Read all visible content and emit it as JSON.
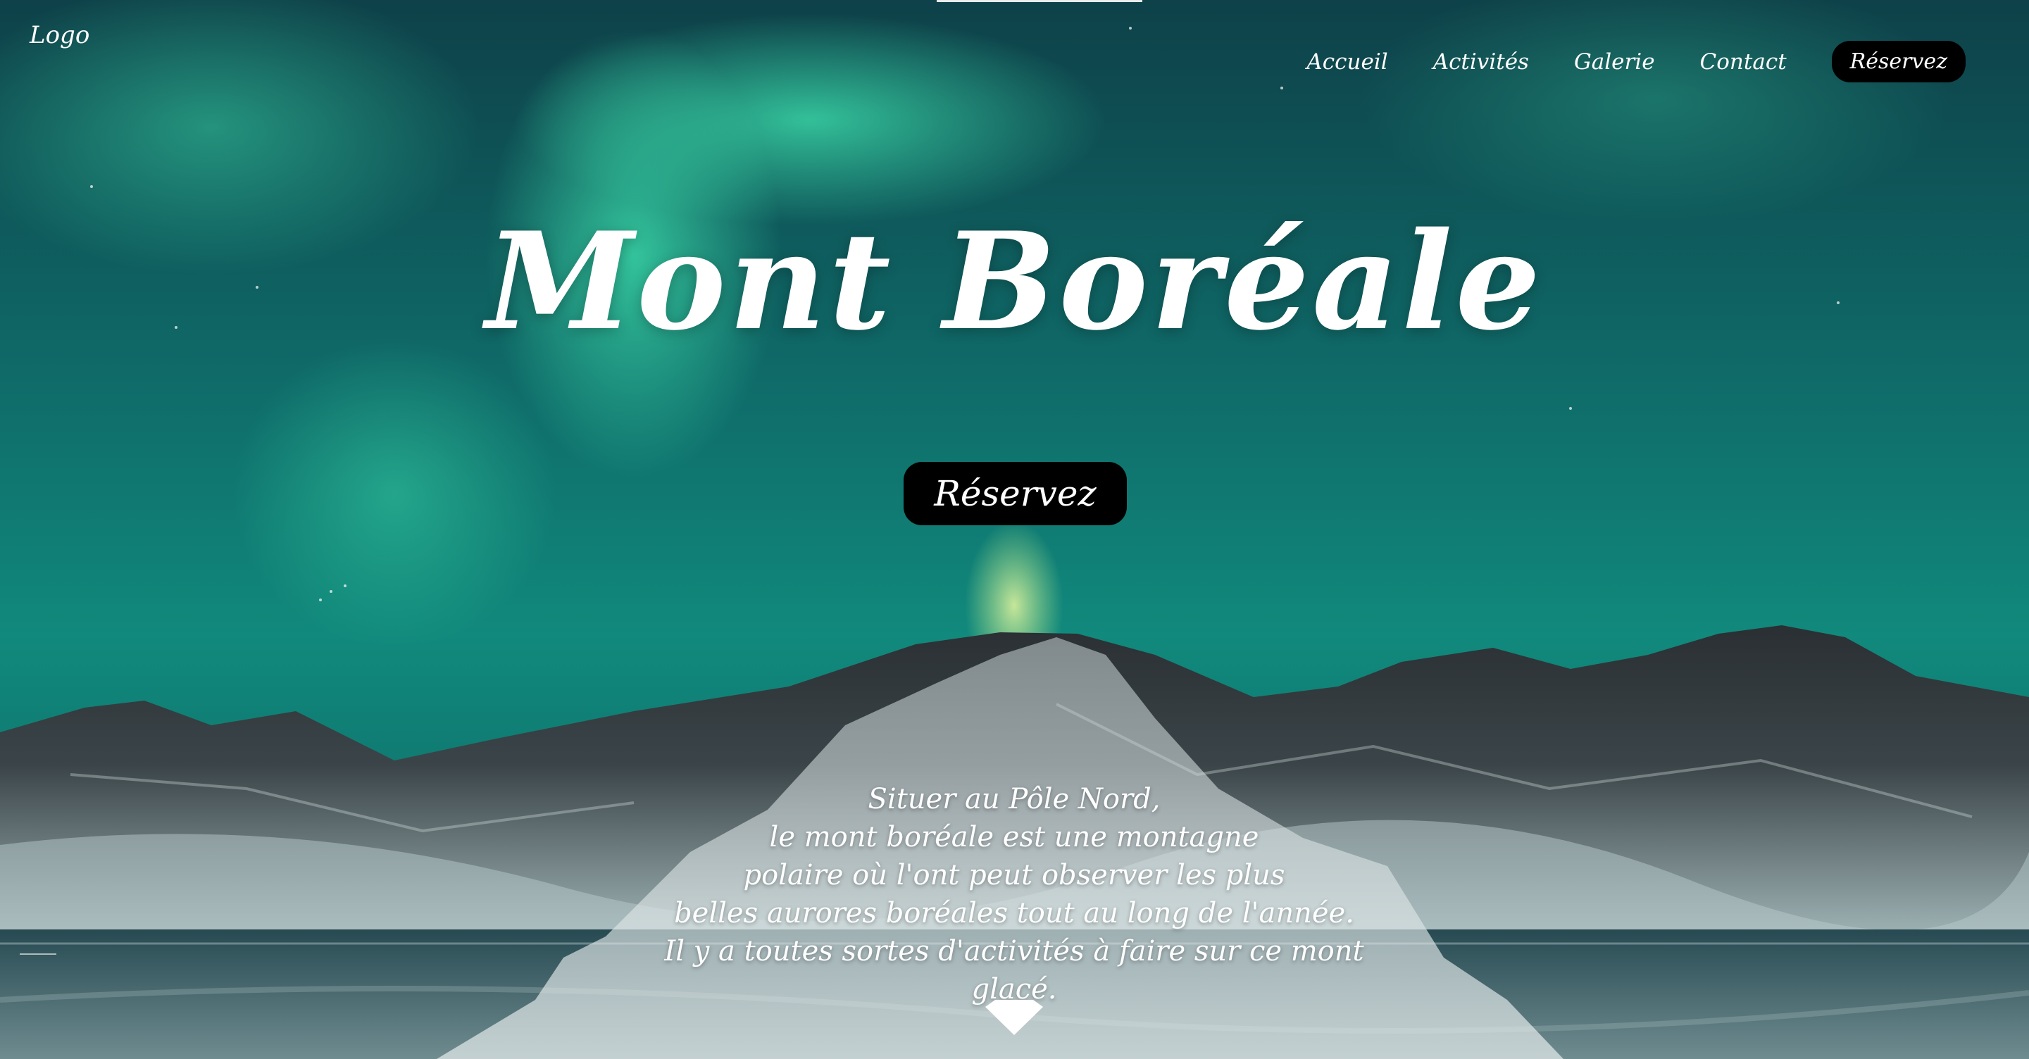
{
  "header": {
    "logo": "Logo",
    "nav": [
      {
        "label": "Accueil"
      },
      {
        "label": "Activités"
      },
      {
        "label": "Galerie"
      },
      {
        "label": "Contact"
      }
    ],
    "cta_label": "Réservez"
  },
  "hero": {
    "title": "Mont Boréale",
    "cta_label": "Réservez"
  },
  "description": {
    "lines": [
      "Situer au Pôle Nord,",
      "le mont boréale est une montagne",
      "polaire où l'ont peut observer les plus",
      "belles aurores boréales tout au long de l'année.",
      "Il y a toutes sortes d'activités à faire sur ce mont glacé."
    ]
  },
  "icons": {
    "scroll": "chevron-down-icon"
  },
  "colors": {
    "sky_top": "#0d3f47",
    "aurora": "#2fd3a0",
    "aurora_glow": "#d9f59a",
    "button": "#000000",
    "text": "#ffffff"
  }
}
